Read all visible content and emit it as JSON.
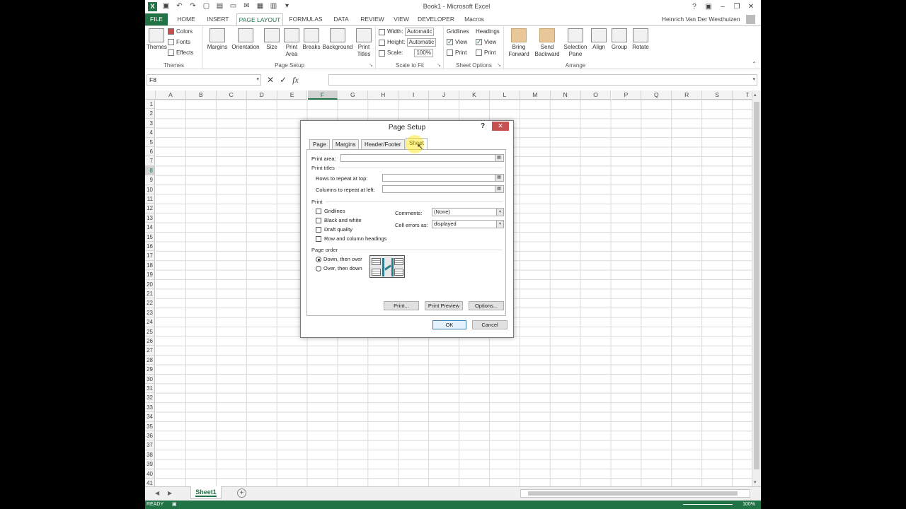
{
  "window": {
    "title": "Book1 - Microsoft Excel",
    "user": "Heinrich Van Der Westhuizen",
    "logo": "X"
  },
  "ribbon_tabs": [
    "FILE",
    "HOME",
    "INSERT",
    "PAGE LAYOUT",
    "FORMULAS",
    "DATA",
    "REVIEW",
    "VIEW",
    "DEVELOPER",
    "Macros"
  ],
  "ribbon": {
    "themes": {
      "button": "Themes",
      "colors": "Colors",
      "fonts": "Fonts",
      "effects": "Effects",
      "group": "Themes"
    },
    "page_setup": {
      "margins": "Margins",
      "orientation": "Orientation",
      "size": "Size",
      "print_area_1": "Print",
      "print_area_2": "Area",
      "breaks": "Breaks",
      "background": "Background",
      "print_titles_1": "Print",
      "print_titles_2": "Titles",
      "group": "Page Setup"
    },
    "scale": {
      "width_label": "Width:",
      "width_value": "Automatic",
      "height_label": "Height:",
      "height_value": "Automatic",
      "scale_label": "Scale:",
      "scale_value": "100%",
      "group": "Scale to Fit"
    },
    "sheet_options": {
      "gridlines": "Gridlines",
      "headings": "Headings",
      "view": "View",
      "print": "Print",
      "group": "Sheet Options"
    },
    "arrange": {
      "bring_1": "Bring",
      "bring_2": "Forward",
      "send_1": "Send",
      "send_2": "Backward",
      "selection_1": "Selection",
      "selection_2": "Pane",
      "align": "Align",
      "group_btn": "Group",
      "rotate": "Rotate",
      "group": "Arrange"
    }
  },
  "formula_bar": {
    "name_box": "F8",
    "fx": "fx",
    "cancel": "✕",
    "enter": "✓"
  },
  "columns": [
    "A",
    "B",
    "C",
    "D",
    "E",
    "F",
    "G",
    "H",
    "I",
    "J",
    "K",
    "L",
    "M",
    "N",
    "O",
    "P",
    "Q",
    "R",
    "S",
    "T"
  ],
  "selected_column": "F",
  "selected_row": 8,
  "rows": [
    1,
    2,
    3,
    4,
    5,
    6,
    7,
    8,
    9,
    10,
    11,
    12,
    13,
    14,
    15,
    16,
    17,
    18,
    19,
    20,
    21,
    22,
    23,
    24,
    25,
    26,
    27,
    28,
    29,
    30,
    31,
    32,
    33,
    34,
    35,
    36,
    37,
    38,
    39,
    40,
    41
  ],
  "sheet_tab": "Sheet1",
  "status": "READY",
  "zoom": "100%",
  "dialog": {
    "title": "Page Setup",
    "help": "?",
    "tabs": [
      "Page",
      "Margins",
      "Header/Footer",
      "Sheet"
    ],
    "active_tab": "Sheet",
    "print_area_label": "Print area:",
    "print_titles_label": "Print titles",
    "rows_repeat_label": "Rows to repeat at top:",
    "cols_repeat_label": "Columns to repeat at left:",
    "print_label": "Print",
    "gridlines": "Gridlines",
    "black_white": "Black and white",
    "draft_quality": "Draft quality",
    "row_col_headings": "Row and column headings",
    "comments_label": "Comments:",
    "comments_value": "(None)",
    "cell_errors_label": "Cell errors as:",
    "cell_errors_value": "displayed",
    "page_order_label": "Page order",
    "down_then_over": "Down, then over",
    "over_then_down": "Over, then down",
    "print_btn": "Print...",
    "print_preview_btn": "Print Preview",
    "options_btn": "Options...",
    "ok_btn": "OK",
    "cancel_btn": "Cancel"
  }
}
